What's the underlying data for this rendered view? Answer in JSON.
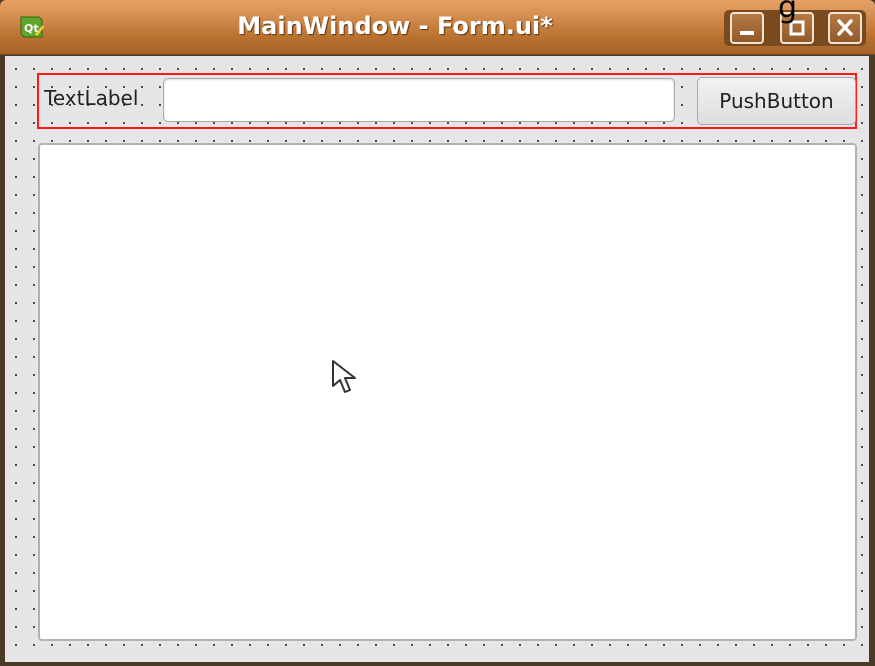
{
  "window": {
    "title": "MainWindow - Form.ui*",
    "app_icon": "qt-icon",
    "controls": [
      "minimize-icon",
      "maximize-icon",
      "close-icon"
    ]
  },
  "form": {
    "label_text": "TextLabel",
    "line_edit_value": "",
    "push_button_label": "PushButton",
    "text_area_value": ""
  },
  "colors": {
    "titlebar": "#d18a4c",
    "layout_selection": "#ff1a1a",
    "form_background": "#e6e6e6",
    "grid_dots": "#333333"
  },
  "cursor": "arrow-cursor-icon"
}
